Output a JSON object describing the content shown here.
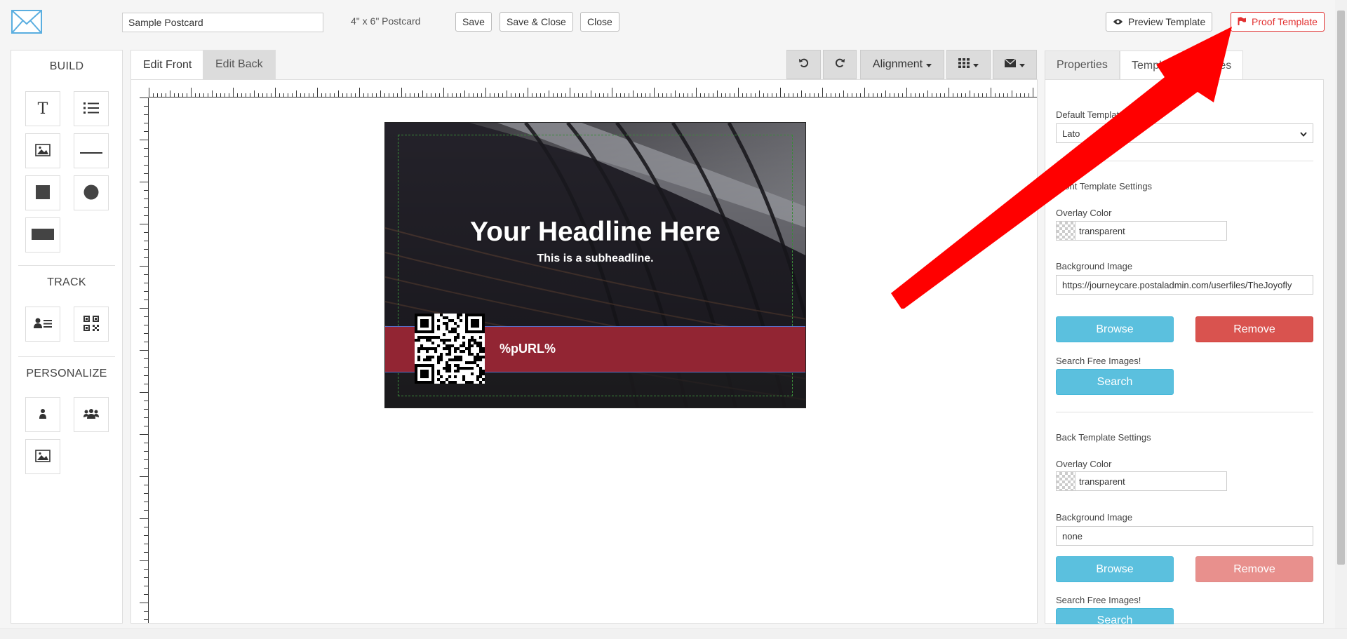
{
  "header": {
    "template_name_value": "Sample Postcard",
    "size_label": "4\" x 6\" Postcard",
    "save_label": "Save",
    "save_close_label": "Save & Close",
    "close_label": "Close",
    "preview_label": "Preview Template",
    "proof_label": "Proof Template"
  },
  "build_panel": {
    "build_title": "BUILD",
    "track_title": "TRACK",
    "personalize_title": "PERSONALIZE",
    "build_tools": [
      "text-tool",
      "list-tool",
      "image-tool",
      "line-tool",
      "square-tool",
      "circle-tool",
      "rectangle-tool"
    ],
    "track_tools": [
      "contact-card-tool",
      "qr-code-tool"
    ],
    "personalize_tools": [
      "person-tool",
      "group-tool",
      "image-tool"
    ]
  },
  "editor": {
    "tab_front": "Edit Front",
    "tab_back": "Edit Back",
    "alignment_label": "Alignment"
  },
  "postcard": {
    "headline": "Your Headline Here",
    "subheadline": "This is a subheadline.",
    "url_text": "%pURL%",
    "band_color": "#922533"
  },
  "right_panel": {
    "tab_properties": "Properties",
    "tab_template": "Template Properties",
    "default_font_label": "Default Template Font",
    "default_font_value": "Lato",
    "front_settings_title": "Front Template Settings",
    "front_overlay_label": "Overlay Color",
    "front_overlay_value": "transparent",
    "front_bg_label": "Background Image",
    "front_bg_value": "https://journeycare.postaladmin.com/userfiles/TheJoyofly",
    "browse_label": "Browse",
    "remove_label": "Remove",
    "search_free_label": "Search Free Images!",
    "search_label": "Search",
    "back_settings_title": "Back Template Settings",
    "back_overlay_label": "Overlay Color",
    "back_overlay_value": "transparent",
    "back_bg_label": "Background Image",
    "back_bg_value": "none"
  },
  "colors": {
    "accent_red": "#e23030",
    "info_blue": "#5bc0de",
    "danger_red": "#d9534f"
  }
}
